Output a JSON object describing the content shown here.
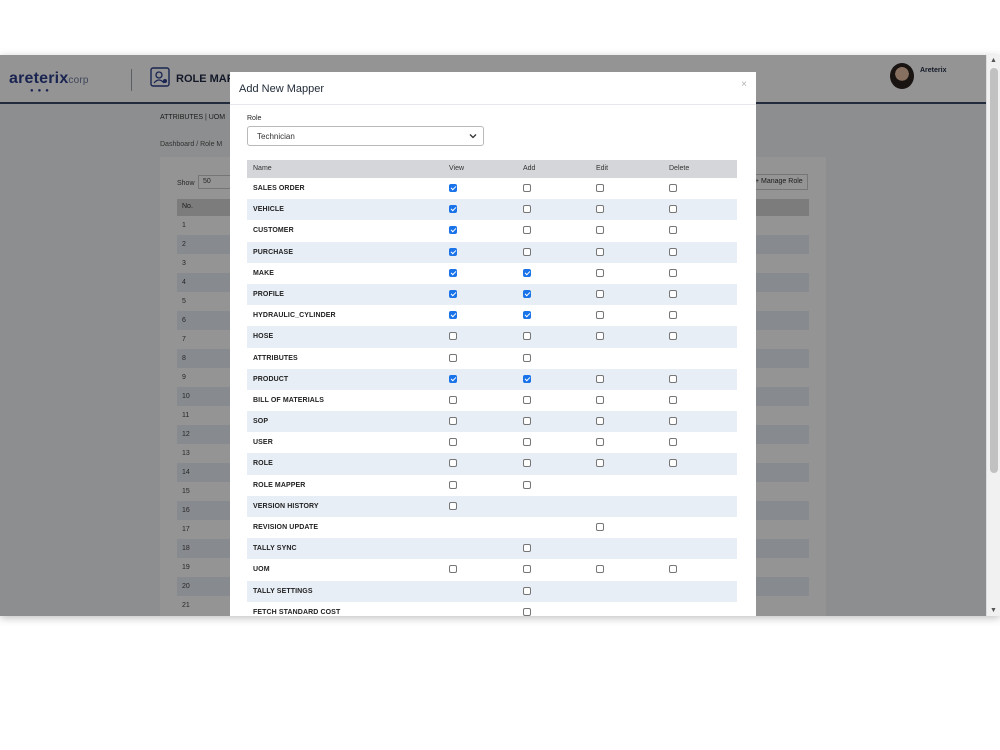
{
  "app": {
    "logo_text": "areterix",
    "logo_suffix": "corp",
    "page_title": "ROLE MAPP",
    "user_name": "Areterix",
    "subnav": "ATTRIBUTES | UOM",
    "breadcrumb": "Dashboard / Role M",
    "show_label": "Show",
    "show_value": "50",
    "manage_button": "+ Manage Role",
    "table_head_no": "No.",
    "row_numbers": [
      "1",
      "2",
      "3",
      "4",
      "5",
      "6",
      "7",
      "8",
      "9",
      "10",
      "11",
      "12",
      "13",
      "14",
      "15",
      "16",
      "17",
      "18",
      "19",
      "20",
      "21"
    ]
  },
  "modal": {
    "title": "Add New Mapper",
    "close": "×",
    "role_label": "Role",
    "role_value": "Technician",
    "columns": {
      "name": "Name",
      "view": "View",
      "add": "Add",
      "edit": "Edit",
      "delete": "Delete"
    },
    "rows": [
      {
        "name": "SALES ORDER",
        "view": true,
        "add": false,
        "edit": false,
        "delete": false
      },
      {
        "name": "VEHICLE",
        "view": true,
        "add": false,
        "edit": false,
        "delete": false
      },
      {
        "name": "CUSTOMER",
        "view": true,
        "add": false,
        "edit": false,
        "delete": false
      },
      {
        "name": "PURCHASE",
        "view": true,
        "add": false,
        "edit": false,
        "delete": false
      },
      {
        "name": "MAKE",
        "view": true,
        "add": true,
        "edit": false,
        "delete": false
      },
      {
        "name": "PROFILE",
        "view": true,
        "add": true,
        "edit": false,
        "delete": false
      },
      {
        "name": "HYDRAULIC_CYLINDER",
        "view": true,
        "add": true,
        "edit": false,
        "delete": false
      },
      {
        "name": "HOSE",
        "view": false,
        "add": false,
        "edit": false,
        "delete": false
      },
      {
        "name": "ATTRIBUTES",
        "view": false,
        "add": false,
        "edit": null,
        "delete": null
      },
      {
        "name": "PRODUCT",
        "view": true,
        "add": true,
        "edit": false,
        "delete": false
      },
      {
        "name": "BILL OF MATERIALS",
        "view": false,
        "add": false,
        "edit": false,
        "delete": false
      },
      {
        "name": "SOP",
        "view": false,
        "add": false,
        "edit": false,
        "delete": false
      },
      {
        "name": "USER",
        "view": false,
        "add": false,
        "edit": false,
        "delete": false
      },
      {
        "name": "ROLE",
        "view": false,
        "add": false,
        "edit": false,
        "delete": false
      },
      {
        "name": "ROLE MAPPER",
        "view": false,
        "add": false,
        "edit": null,
        "delete": null
      },
      {
        "name": "VERSION HISTORY",
        "view": false,
        "add": null,
        "edit": null,
        "delete": null
      },
      {
        "name": "REVISION UPDATE",
        "view": null,
        "add": null,
        "edit": false,
        "delete": null
      },
      {
        "name": "TALLY SYNC",
        "view": null,
        "add": false,
        "edit": null,
        "delete": null
      },
      {
        "name": "UOM",
        "view": false,
        "add": false,
        "edit": false,
        "delete": false
      },
      {
        "name": "TALLY SETTINGS",
        "view": null,
        "add": false,
        "edit": null,
        "delete": null
      },
      {
        "name": "FETCH STANDARD COST",
        "view": null,
        "add": false,
        "edit": null,
        "delete": null
      }
    ]
  },
  "colors": {
    "accent": "#1a73e8",
    "brand": "#2d3f8c",
    "header_row": "#d4d6d9",
    "stripe": "#e8eef6"
  }
}
